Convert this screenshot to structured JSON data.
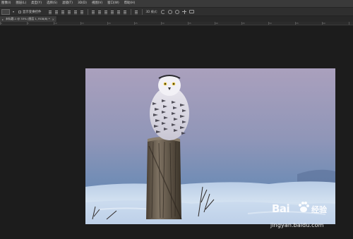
{
  "menubar": {
    "items": [
      {
        "label": "图像(I)"
      },
      {
        "label": "图层(L)"
      },
      {
        "label": "类型(Y)"
      },
      {
        "label": "选择(S)"
      },
      {
        "label": "滤镜(T)"
      },
      {
        "label": "3D(D)"
      },
      {
        "label": "视图(V)"
      },
      {
        "label": "窗口(W)"
      },
      {
        "label": "帮助(H)"
      }
    ]
  },
  "options_bar": {
    "show_transform_controls_label": "显示变换控件",
    "mode_label": "3D 模式:"
  },
  "document_tab": {
    "label": "未标题-1 @ 33% (图层 1, RGB/8) *",
    "close_glyph": "×"
  },
  "ruler": {
    "ticks": [
      "0",
      "5",
      "10",
      "15",
      "20",
      "25",
      "30",
      "35",
      "40",
      "45",
      "50",
      "55",
      "60"
    ]
  },
  "watermark": {
    "logo_text": "Bai",
    "brand_text": "经验",
    "url": "jingyan.baidu.com"
  },
  "colors": {
    "menubar_bg": "#3a3a3a",
    "canvas_bg": "#1c1c1c",
    "sky_top": "#a59bb8",
    "sky_bottom": "#6f8db3"
  }
}
